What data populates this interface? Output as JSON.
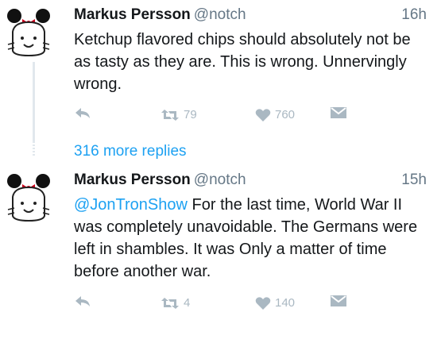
{
  "colors": {
    "accent": "#1da1f2",
    "text": "#14171a",
    "muted": "#657786",
    "icon": "#aab8c2"
  },
  "tweets": [
    {
      "name": "Markus Persson",
      "handle": "@notch",
      "time": "16h",
      "text": "Ketchup flavored chips should absolutely not be as tasty as they are. This is wrong. Unnervingly wrong.",
      "retweets": "79",
      "likes": "760",
      "icons": [
        "reply-icon",
        "retweet-icon",
        "heart-icon",
        "dm-icon"
      ]
    },
    {
      "name": "Markus Persson",
      "handle": "@notch",
      "time": "15h",
      "mention": "@JonTronShow",
      "text": "For the last time, World War II was completely unavoidable. The Germans were left in shambles. It was Only a matter of time before another war.",
      "retweets": "4",
      "likes": "140",
      "icons": [
        "reply-icon",
        "retweet-icon",
        "heart-icon",
        "dm-icon"
      ]
    }
  ],
  "more_replies": "316 more replies"
}
